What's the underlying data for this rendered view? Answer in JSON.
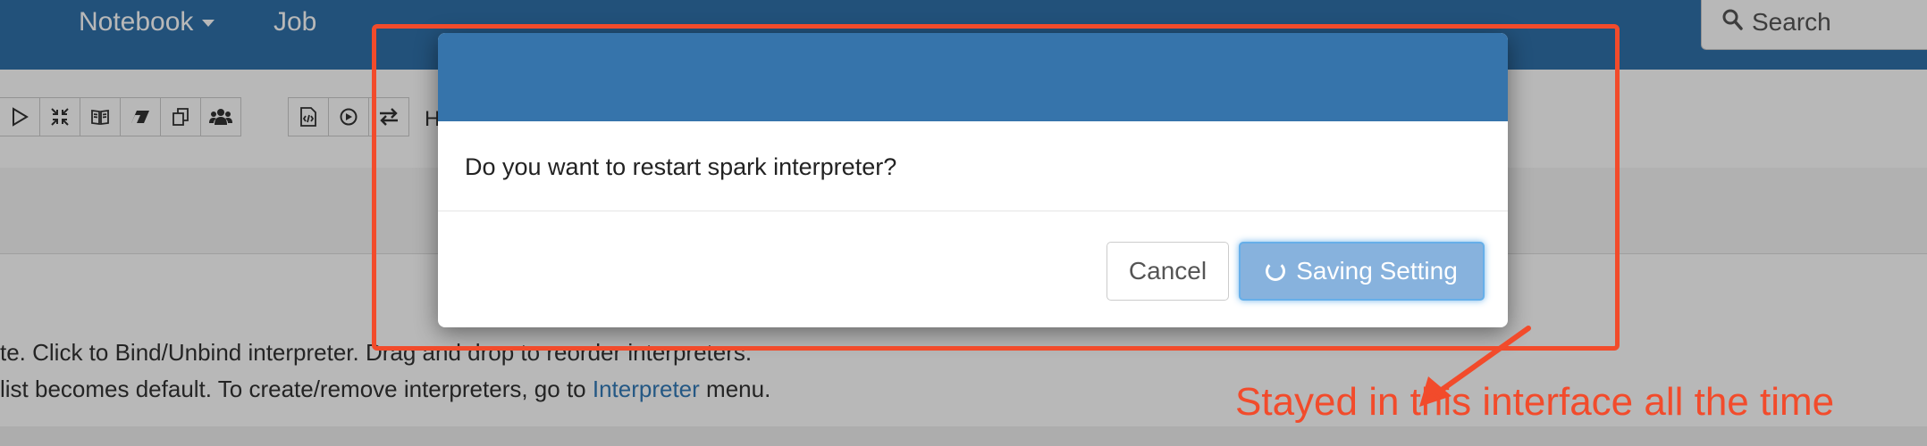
{
  "navbar": {
    "notebook_label": "Notebook",
    "job_label": "Job",
    "search_label": "Search"
  },
  "toolbar": {
    "icons": [
      "play-icon",
      "collapse-icon",
      "book-icon",
      "eraser-icon",
      "copy-icon",
      "users-icon",
      "code-file-icon",
      "arrow-circle-icon",
      "swap-icon"
    ],
    "partial_label": "H"
  },
  "body": {
    "line1_text": "te. Click to Bind/Unbind interpreter. Drag and drop to reorder interpreters.",
    "line2_prefix": " list becomes default. To create/remove interpreters, go to ",
    "line2_link": "Interpreter",
    "line2_suffix": " menu."
  },
  "dialog": {
    "message": "Do you want to restart spark interpreter?",
    "cancel_label": "Cancel",
    "save_label": "Saving Setting"
  },
  "annotation": {
    "text": "Stayed in this interface all the time",
    "color": "#f24b2b"
  },
  "colors": {
    "navbar": "#3071a9",
    "modal_header": "#3674ab",
    "link": "#337ab7"
  }
}
